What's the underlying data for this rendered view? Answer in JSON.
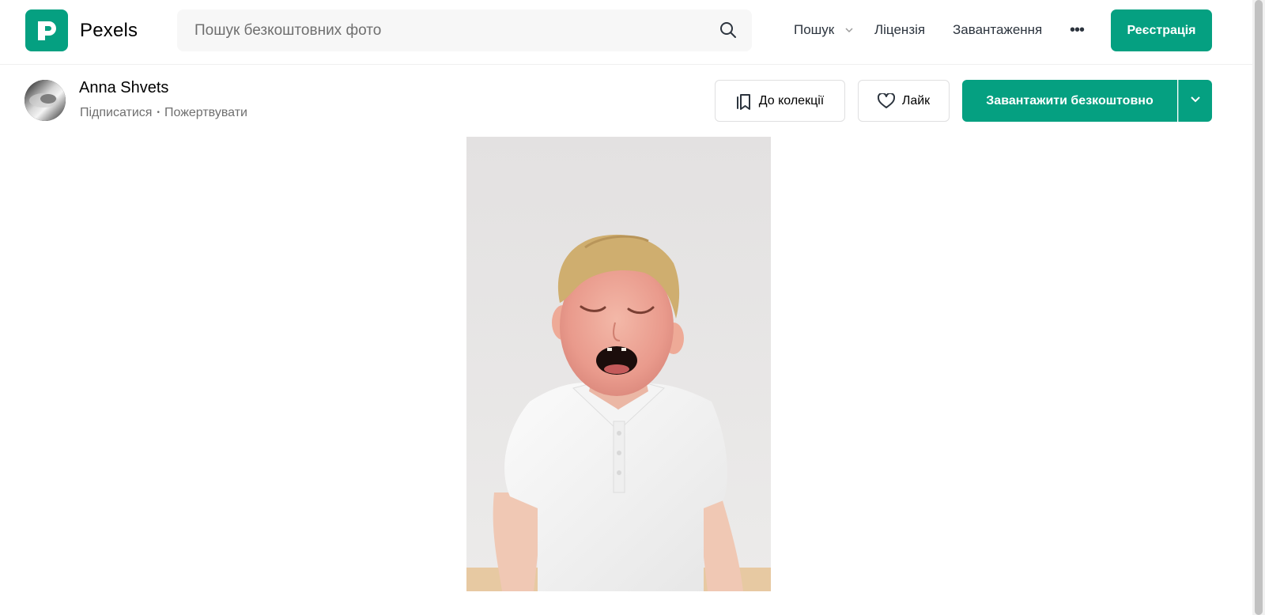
{
  "header": {
    "logo_text": "Pexels",
    "search_placeholder": "Пошук безкоштовних фото",
    "nav": {
      "search": "Пошук",
      "license": "Ліцензія",
      "downloads": "Завантаження",
      "more": "•••"
    },
    "register": "Реєстрація"
  },
  "author": {
    "name": "Anna Shvets",
    "follow": "Підписатися",
    "separator": "•",
    "donate": "Пожертвувати"
  },
  "actions": {
    "collect": "До колекції",
    "like": "Лайк",
    "download": "Завантажити безкоштовно"
  },
  "colors": {
    "brand": "#05a081",
    "text": "#2c343e",
    "muted": "#6f6f6f"
  },
  "icons": [
    "search-icon",
    "chevron-down-icon",
    "bookmark-icon",
    "heart-icon",
    "more-dots-icon"
  ]
}
